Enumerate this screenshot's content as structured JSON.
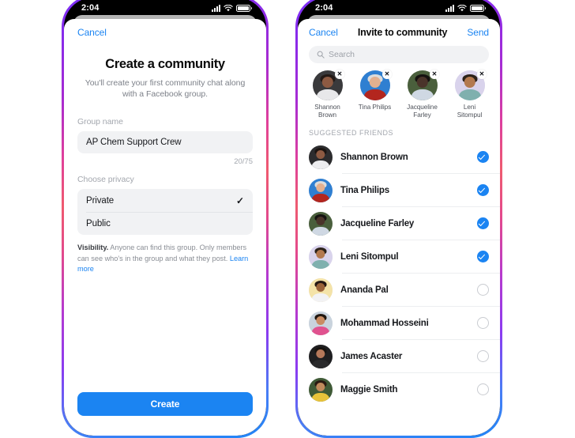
{
  "status_bar": {
    "time": "2:04",
    "signal_icon": "cellular-signal-icon",
    "wifi_icon": "wifi-icon",
    "battery_icon": "battery-icon"
  },
  "colors": {
    "accent_blue": "#1b84f2",
    "field_gray": "#f1f2f4",
    "label_gray": "#a3a7ae",
    "text_dark": "#16181c",
    "frame_gradient_start": "#7b2ff7",
    "frame_gradient_mid": "#ee5b70",
    "frame_gradient_end": "#1f86f7"
  },
  "left_screen": {
    "nav": {
      "cancel_label": "Cancel"
    },
    "title": "Create a community",
    "subtitle": "You'll create your first community chat along with a Facebook group.",
    "group_name": {
      "label": "Group name",
      "value": "AP Chem Support Crew",
      "placeholder": "Group name",
      "counter": "20/75"
    },
    "privacy": {
      "label": "Choose privacy",
      "options": [
        {
          "label": "Private",
          "selected": true
        },
        {
          "label": "Public",
          "selected": false
        }
      ],
      "check_icon": "checkmark-icon"
    },
    "visibility": {
      "bold_lead": "Visibility.",
      "text": " Anyone can find this group. Only members can see who's in the group and what they post. ",
      "link": "Learn more"
    },
    "primary_button": "Create"
  },
  "right_screen": {
    "nav": {
      "cancel_label": "Cancel",
      "title": "Invite to community",
      "send_label": "Send"
    },
    "search": {
      "placeholder": "Search",
      "icon": "search-icon",
      "value": ""
    },
    "selected_chips": [
      {
        "name": "Shannon Brown",
        "line1": "Shannon",
        "line2": "Brown",
        "remove_icon": "close-icon",
        "bg": "#3a3a3c",
        "skin": "#8d5a42",
        "hair": "#241a16",
        "shirt": "#e8e8ea"
      },
      {
        "name": "Tina Philips",
        "line1": "Tina Philips",
        "line2": "",
        "remove_icon": "close-icon",
        "bg": "#2f7fd1",
        "skin": "#e3b08f",
        "hair": "#dcdcdc",
        "shirt": "#b3261e"
      },
      {
        "name": "Jacqueline Farley",
        "line1": "Jacqueline",
        "line2": "Farley",
        "remove_icon": "close-icon",
        "bg": "#4a5f3c",
        "skin": "#4a342a",
        "hair": "#151210",
        "shirt": "#cfd8e3"
      },
      {
        "name": "Leni Sitompul",
        "line1": "Leni",
        "line2": "Sitompul",
        "remove_icon": "close-icon",
        "bg": "#d9d3ec",
        "skin": "#b3794f",
        "hair": "#2b2119",
        "shirt": "#7fb0ae"
      }
    ],
    "section_header": "SUGGESTED FRIENDS",
    "friends": [
      {
        "name": "Shannon Brown",
        "selected": true,
        "bg": "#2c2c2e",
        "skin": "#8d5a42",
        "hair": "#1b1411",
        "shirt": "#ededef"
      },
      {
        "name": "Tina Philips",
        "selected": true,
        "bg": "#2f7fd1",
        "skin": "#e3b08f",
        "hair": "#dcdcdc",
        "shirt": "#b3261e"
      },
      {
        "name": "Jacqueline Farley",
        "selected": true,
        "bg": "#4a5f3c",
        "skin": "#4a342a",
        "hair": "#151210",
        "shirt": "#cfd8e3"
      },
      {
        "name": "Leni Sitompul",
        "selected": true,
        "bg": "#d9d3ec",
        "skin": "#b3794f",
        "hair": "#2b2119",
        "shirt": "#7fb0ae"
      },
      {
        "name": "Ananda Pal",
        "selected": false,
        "bg": "#f4e3a8",
        "skin": "#9a6238",
        "hair": "#241712",
        "shirt": "#f2f2f4"
      },
      {
        "name": "Mohammad Hosseini",
        "selected": false,
        "bg": "#c9d3dd",
        "skin": "#c98c63",
        "hair": "#20160f",
        "shirt": "#e0528f"
      },
      {
        "name": "James Acaster",
        "selected": false,
        "bg": "#1f1f21",
        "skin": "#b5785a",
        "hair": "#171310",
        "shirt": "#2a2a2c"
      },
      {
        "name": "Maggie Smith",
        "selected": false,
        "bg": "#3f5a36",
        "skin": "#c08a5c",
        "hair": "#2a1a12",
        "shirt": "#e8c33a"
      }
    ],
    "check_on_icon": "check-circle-filled-icon",
    "check_off_icon": "circle-outline-icon"
  }
}
